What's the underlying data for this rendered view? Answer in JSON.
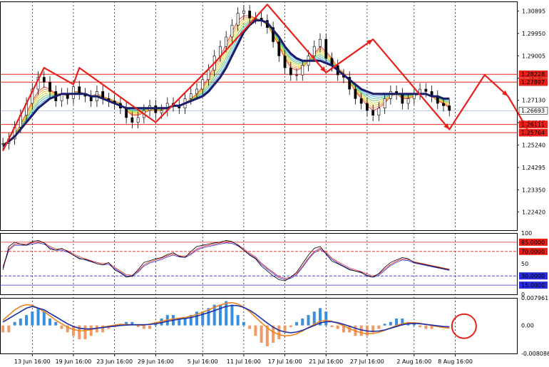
{
  "chart_data": {
    "type": "line",
    "title": "",
    "price_axis": {
      "ylim": [
        1.2165,
        1.313
      ],
      "ticks": [
        "1.30895",
        "1.29950",
        "1.29005",
        "1.28060",
        "1.27130",
        "1.26185",
        "1.25240",
        "1.24295",
        "1.23350",
        "1.22420"
      ],
      "tick_values": [
        1.30895,
        1.2995,
        1.29005,
        1.2806,
        1.2713,
        1.26185,
        1.2524,
        1.24295,
        1.2335,
        1.2242
      ]
    },
    "x_ticks": [
      "13 Jun 16:00",
      "19 Jun 16:00",
      "23 Jun 16:00",
      "29 Jun 16:00",
      "5 Jul 16:00",
      "11 Jul 16:00",
      "17 Jul 16:00",
      "21 Jul 16:00",
      "27 Jul 16:00",
      "2 Aug 16:00",
      "8 Aug 16:00"
    ],
    "x_tick_index": [
      5,
      12,
      19,
      26,
      34,
      41,
      48,
      55,
      62,
      70,
      77
    ],
    "n_bars": 88,
    "price_levels": [
      {
        "label": "1.28228",
        "value": 1.28228,
        "color": "#e8201a"
      },
      {
        "label": "1.27897",
        "value": 1.27897,
        "color": "#e8201a"
      },
      {
        "label": "1.26693",
        "value": 1.26693,
        "color": "#ffffff"
      },
      {
        "label": "1.26111",
        "value": 1.26111,
        "color": "#e8201a"
      },
      {
        "label": "1.25764",
        "value": 1.25764,
        "color": "#e8201a"
      }
    ],
    "close": [
      1.253,
      1.255,
      1.26,
      1.265,
      1.27,
      1.276,
      1.281,
      1.279,
      1.275,
      1.271,
      1.274,
      1.272,
      1.277,
      1.274,
      1.273,
      1.271,
      1.275,
      1.272,
      1.271,
      1.27,
      1.268,
      1.264,
      1.262,
      1.264,
      1.267,
      1.269,
      1.266,
      1.267,
      1.27,
      1.269,
      1.268,
      1.272,
      1.274,
      1.276,
      1.28,
      1.284,
      1.29,
      1.294,
      1.298,
      1.303,
      1.308,
      1.309,
      1.306,
      1.306,
      1.305,
      1.302,
      1.296,
      1.29,
      1.285,
      1.282,
      1.282,
      1.286,
      1.29,
      1.294,
      1.297,
      1.289,
      1.286,
      1.282,
      1.281,
      1.276,
      1.272,
      1.27,
      1.267,
      1.265,
      1.268,
      1.272,
      1.275,
      1.274,
      1.27,
      1.272,
      1.274,
      1.276,
      1.275,
      1.273,
      1.27,
      1.269,
      1.267
    ],
    "ma_slow": [
      1.252,
      1.254,
      1.256,
      1.259,
      1.262,
      1.265,
      1.268,
      1.27,
      1.272,
      1.273,
      1.274,
      1.274,
      1.274,
      1.274,
      1.274,
      1.273,
      1.273,
      1.272,
      1.271,
      1.27,
      1.269,
      1.268,
      1.268,
      1.268,
      1.268,
      1.268,
      1.268,
      1.268,
      1.268,
      1.269,
      1.269,
      1.27,
      1.271,
      1.272,
      1.273,
      1.275,
      1.278,
      1.281,
      1.285,
      1.29,
      1.295,
      1.3,
      1.303,
      1.305,
      1.305,
      1.304,
      1.301,
      1.298,
      1.294,
      1.291,
      1.289,
      1.288,
      1.288,
      1.288,
      1.288,
      1.287,
      1.286,
      1.284,
      1.282,
      1.28,
      1.278,
      1.276,
      1.275,
      1.274,
      1.274,
      1.274,
      1.274,
      1.274,
      1.274,
      1.274,
      1.274,
      1.274,
      1.274,
      1.273,
      1.273,
      1.272,
      1.272
    ],
    "ma_fast": [
      1.253,
      1.254,
      1.257,
      1.261,
      1.266,
      1.271,
      1.275,
      1.277,
      1.276,
      1.274,
      1.274,
      1.273,
      1.275,
      1.275,
      1.274,
      1.273,
      1.274,
      1.273,
      1.272,
      1.271,
      1.27,
      1.267,
      1.265,
      1.265,
      1.266,
      1.267,
      1.267,
      1.267,
      1.268,
      1.269,
      1.269,
      1.27,
      1.272,
      1.274,
      1.277,
      1.281,
      1.286,
      1.29,
      1.295,
      1.3,
      1.305,
      1.307,
      1.307,
      1.306,
      1.305,
      1.303,
      1.299,
      1.294,
      1.289,
      1.285,
      1.284,
      1.285,
      1.288,
      1.291,
      1.294,
      1.292,
      1.289,
      1.285,
      1.283,
      1.279,
      1.275,
      1.272,
      1.269,
      1.267,
      1.268,
      1.27,
      1.273,
      1.274,
      1.272,
      1.272,
      1.273,
      1.274,
      1.274,
      1.273,
      1.271,
      1.27,
      1.268
    ],
    "zigzag": [
      [
        0,
        1.25
      ],
      [
        7,
        1.285
      ],
      [
        12,
        1.278
      ],
      [
        13,
        1.285
      ],
      [
        26,
        1.262
      ],
      [
        36,
        1.287
      ],
      [
        45,
        1.3117
      ],
      [
        55,
        1.283
      ],
      [
        63,
        1.297
      ],
      [
        76,
        1.259
      ],
      [
        82,
        1.282
      ],
      [
        86,
        1.273
      ],
      [
        90,
        1.256
      ]
    ],
    "oscillator": {
      "levels": [
        {
          "label": "85.0000",
          "value": 85,
          "color": "#e8201a"
        },
        {
          "label": "70.0000",
          "value": 70,
          "color": "#e8201a"
        },
        {
          "label": "30.0000",
          "value": 30,
          "color": "#2b2be0"
        },
        {
          "label": "15.0000",
          "value": 15,
          "color": "#2b2be0"
        }
      ],
      "axis_labels": [
        "100",
        "50",
        "0"
      ],
      "k": [
        40,
        78,
        85,
        82,
        80,
        86,
        88,
        84,
        74,
        72,
        75,
        70,
        64,
        58,
        57,
        54,
        50,
        48,
        52,
        40,
        35,
        28,
        30,
        40,
        52,
        55,
        58,
        60,
        65,
        68,
        62,
        60,
        70,
        78,
        80,
        82,
        84,
        85,
        88,
        86,
        80,
        72,
        64,
        58,
        46,
        38,
        30,
        24,
        22,
        28,
        36,
        50,
        64,
        75,
        78,
        66,
        54,
        50,
        45,
        40,
        38,
        36,
        30,
        28,
        34,
        44,
        52,
        56,
        60,
        58,
        52,
        50,
        48,
        46,
        44,
        42,
        40
      ],
      "d": [
        45,
        74,
        82,
        82,
        82,
        84,
        86,
        84,
        78,
        74,
        74,
        71,
        66,
        61,
        58,
        55,
        52,
        50,
        51,
        44,
        38,
        32,
        31,
        38,
        48,
        53,
        56,
        59,
        63,
        66,
        63,
        62,
        67,
        74,
        78,
        80,
        82,
        84,
        86,
        85,
        81,
        74,
        67,
        61,
        51,
        43,
        36,
        29,
        26,
        28,
        34,
        46,
        59,
        70,
        75,
        69,
        59,
        53,
        48,
        43,
        40,
        37,
        33,
        30,
        33,
        41,
        49,
        54,
        58,
        57,
        53,
        51,
        49,
        47,
        45,
        43,
        41
      ]
    },
    "macd": {
      "labels": [
        "0.0079617",
        "0.00",
        "-0.0080863"
      ],
      "ylim": [
        -0.0080863,
        0.0079617
      ],
      "hist": [
        -0.002,
        -0.002,
        0.001,
        0.002,
        0.003,
        0.004,
        0.005,
        0.004,
        0.002,
        0.001,
        -0.001,
        -0.002,
        -0.003,
        -0.004,
        -0.004,
        -0.003,
        -0.002,
        -0.002,
        -0.001,
        -0.0005,
        0.0005,
        0.001,
        0.001,
        -0.0005,
        -0.001,
        -0.001,
        0.001,
        0.002,
        0.003,
        0.003,
        0.002,
        0.002,
        0.003,
        0.004,
        0.004,
        0.005,
        0.006,
        0.006,
        0.007,
        0.006,
        0.003,
        0.001,
        -0.001,
        -0.003,
        -0.005,
        -0.006,
        -0.005,
        -0.004,
        -0.002,
        -0.0005,
        0.001,
        0.002,
        0.003,
        0.004,
        0.005,
        0.004,
        -0.0005,
        -0.001,
        -0.002,
        -0.002,
        -0.003,
        -0.003,
        -0.003,
        -0.002,
        -0.001,
        0.0005,
        0.001,
        0.002,
        0.002,
        0.001,
        0.0005,
        -0.0005,
        -0.001,
        -0.001,
        -0.0005
      ],
      "signal": [
        0.001,
        0.002,
        0.003,
        0.004,
        0.005,
        0.0055,
        0.005,
        0.0045,
        0.0035,
        0.0025,
        0.0015,
        0.0005,
        -0.0003,
        -0.0008,
        -0.001,
        -0.001,
        -0.0008,
        -0.0006,
        -0.0004,
        -0.0002,
        0,
        0.0001,
        0.0002,
        0.0002,
        0.0002,
        0.0003,
        0.0005,
        0.0008,
        0.0012,
        0.0015,
        0.0018,
        0.002,
        0.0023,
        0.0027,
        0.0032,
        0.0037,
        0.0043,
        0.0049,
        0.0055,
        0.0058,
        0.0057,
        0.0052,
        0.0044,
        0.0033,
        0.002,
        0.0007,
        -0.0005,
        -0.0014,
        -0.0019,
        -0.0021,
        -0.0019,
        -0.0014,
        -0.0007,
        0,
        0.0007,
        0.0011,
        0.0011,
        0.0008,
        0.0003,
        -0.0002,
        -0.0008,
        -0.0013,
        -0.0016,
        -0.0017,
        -0.0016,
        -0.0013,
        -0.0008,
        -0.0003,
        0.0002,
        0.0005,
        0.0006,
        0.0005,
        0.0003,
        0.0001,
        -0.0001,
        -0.0003,
        -0.0004
      ],
      "macd_line": [
        0.0015,
        0.003,
        0.0045,
        0.0055,
        0.006,
        0.0058,
        0.005,
        0.004,
        0.0028,
        0.0015,
        0.0005,
        -0.0005,
        -0.0012,
        -0.0015,
        -0.0015,
        -0.0012,
        -0.0008,
        -0.0005,
        -0.0002,
        0.0001,
        0.0003,
        0.0003,
        0.0002,
        0.0001,
        0.0001,
        0.0004,
        0.0008,
        0.0012,
        0.0016,
        0.0019,
        0.0021,
        0.0023,
        0.0027,
        0.0032,
        0.0038,
        0.0045,
        0.0052,
        0.0059,
        0.0064,
        0.0066,
        0.0062,
        0.0053,
        0.004,
        0.0024,
        0.0008,
        -0.0007,
        -0.0019,
        -0.0027,
        -0.003,
        -0.0029,
        -0.0024,
        -0.0016,
        -0.0006,
        0.0004,
        0.0012,
        0.0015,
        0.0012,
        0.0006,
        -0.0001,
        -0.0009,
        -0.0016,
        -0.0021,
        -0.0024,
        -0.0023,
        -0.002,
        -0.0014,
        -0.0007,
        0,
        0.0005,
        0.0008,
        0.0008,
        0.0006,
        0.0003,
        0,
        -0.0003,
        -0.0006,
        -0.0008
      ]
    }
  }
}
